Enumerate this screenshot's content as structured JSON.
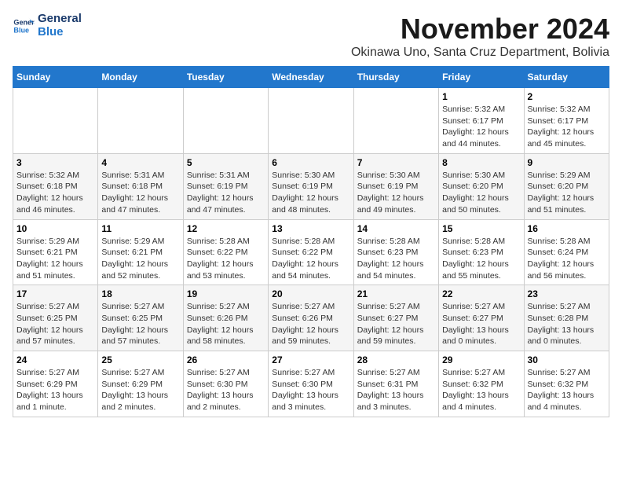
{
  "logo": {
    "line1": "General",
    "line2": "Blue"
  },
  "title": "November 2024",
  "location": "Okinawa Uno, Santa Cruz Department, Bolivia",
  "days_of_week": [
    "Sunday",
    "Monday",
    "Tuesday",
    "Wednesday",
    "Thursday",
    "Friday",
    "Saturday"
  ],
  "weeks": [
    [
      {
        "day": "",
        "info": ""
      },
      {
        "day": "",
        "info": ""
      },
      {
        "day": "",
        "info": ""
      },
      {
        "day": "",
        "info": ""
      },
      {
        "day": "",
        "info": ""
      },
      {
        "day": "1",
        "info": "Sunrise: 5:32 AM\nSunset: 6:17 PM\nDaylight: 12 hours\nand 44 minutes."
      },
      {
        "day": "2",
        "info": "Sunrise: 5:32 AM\nSunset: 6:17 PM\nDaylight: 12 hours\nand 45 minutes."
      }
    ],
    [
      {
        "day": "3",
        "info": "Sunrise: 5:32 AM\nSunset: 6:18 PM\nDaylight: 12 hours\nand 46 minutes."
      },
      {
        "day": "4",
        "info": "Sunrise: 5:31 AM\nSunset: 6:18 PM\nDaylight: 12 hours\nand 47 minutes."
      },
      {
        "day": "5",
        "info": "Sunrise: 5:31 AM\nSunset: 6:19 PM\nDaylight: 12 hours\nand 47 minutes."
      },
      {
        "day": "6",
        "info": "Sunrise: 5:30 AM\nSunset: 6:19 PM\nDaylight: 12 hours\nand 48 minutes."
      },
      {
        "day": "7",
        "info": "Sunrise: 5:30 AM\nSunset: 6:19 PM\nDaylight: 12 hours\nand 49 minutes."
      },
      {
        "day": "8",
        "info": "Sunrise: 5:30 AM\nSunset: 6:20 PM\nDaylight: 12 hours\nand 50 minutes."
      },
      {
        "day": "9",
        "info": "Sunrise: 5:29 AM\nSunset: 6:20 PM\nDaylight: 12 hours\nand 51 minutes."
      }
    ],
    [
      {
        "day": "10",
        "info": "Sunrise: 5:29 AM\nSunset: 6:21 PM\nDaylight: 12 hours\nand 51 minutes."
      },
      {
        "day": "11",
        "info": "Sunrise: 5:29 AM\nSunset: 6:21 PM\nDaylight: 12 hours\nand 52 minutes."
      },
      {
        "day": "12",
        "info": "Sunrise: 5:28 AM\nSunset: 6:22 PM\nDaylight: 12 hours\nand 53 minutes."
      },
      {
        "day": "13",
        "info": "Sunrise: 5:28 AM\nSunset: 6:22 PM\nDaylight: 12 hours\nand 54 minutes."
      },
      {
        "day": "14",
        "info": "Sunrise: 5:28 AM\nSunset: 6:23 PM\nDaylight: 12 hours\nand 54 minutes."
      },
      {
        "day": "15",
        "info": "Sunrise: 5:28 AM\nSunset: 6:23 PM\nDaylight: 12 hours\nand 55 minutes."
      },
      {
        "day": "16",
        "info": "Sunrise: 5:28 AM\nSunset: 6:24 PM\nDaylight: 12 hours\nand 56 minutes."
      }
    ],
    [
      {
        "day": "17",
        "info": "Sunrise: 5:27 AM\nSunset: 6:25 PM\nDaylight: 12 hours\nand 57 minutes."
      },
      {
        "day": "18",
        "info": "Sunrise: 5:27 AM\nSunset: 6:25 PM\nDaylight: 12 hours\nand 57 minutes."
      },
      {
        "day": "19",
        "info": "Sunrise: 5:27 AM\nSunset: 6:26 PM\nDaylight: 12 hours\nand 58 minutes."
      },
      {
        "day": "20",
        "info": "Sunrise: 5:27 AM\nSunset: 6:26 PM\nDaylight: 12 hours\nand 59 minutes."
      },
      {
        "day": "21",
        "info": "Sunrise: 5:27 AM\nSunset: 6:27 PM\nDaylight: 12 hours\nand 59 minutes."
      },
      {
        "day": "22",
        "info": "Sunrise: 5:27 AM\nSunset: 6:27 PM\nDaylight: 13 hours\nand 0 minutes."
      },
      {
        "day": "23",
        "info": "Sunrise: 5:27 AM\nSunset: 6:28 PM\nDaylight: 13 hours\nand 0 minutes."
      }
    ],
    [
      {
        "day": "24",
        "info": "Sunrise: 5:27 AM\nSunset: 6:29 PM\nDaylight: 13 hours\nand 1 minute."
      },
      {
        "day": "25",
        "info": "Sunrise: 5:27 AM\nSunset: 6:29 PM\nDaylight: 13 hours\nand 2 minutes."
      },
      {
        "day": "26",
        "info": "Sunrise: 5:27 AM\nSunset: 6:30 PM\nDaylight: 13 hours\nand 2 minutes."
      },
      {
        "day": "27",
        "info": "Sunrise: 5:27 AM\nSunset: 6:30 PM\nDaylight: 13 hours\nand 3 minutes."
      },
      {
        "day": "28",
        "info": "Sunrise: 5:27 AM\nSunset: 6:31 PM\nDaylight: 13 hours\nand 3 minutes."
      },
      {
        "day": "29",
        "info": "Sunrise: 5:27 AM\nSunset: 6:32 PM\nDaylight: 13 hours\nand 4 minutes."
      },
      {
        "day": "30",
        "info": "Sunrise: 5:27 AM\nSunset: 6:32 PM\nDaylight: 13 hours\nand 4 minutes."
      }
    ]
  ]
}
